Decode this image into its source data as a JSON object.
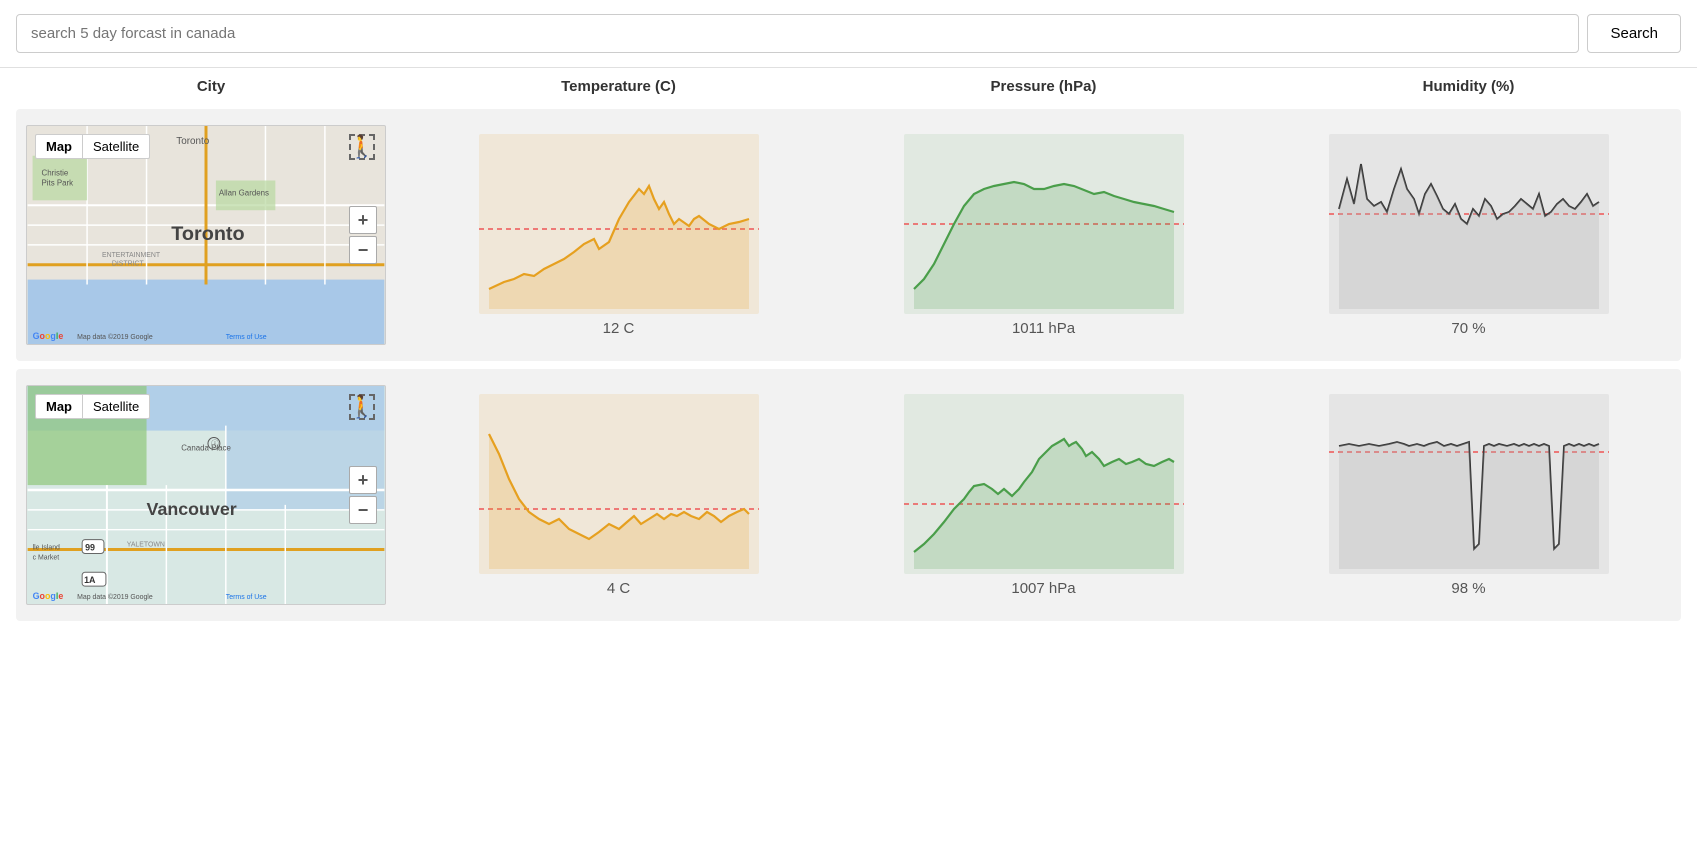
{
  "search": {
    "placeholder": "search 5 day forcast in canada",
    "button_label": "Search"
  },
  "columns": {
    "city": "City",
    "temperature": "Temperature (C)",
    "pressure": "Pressure (hPa)",
    "humidity": "Humidity (%)"
  },
  "cities": [
    {
      "name": "Toronto",
      "temperature_value": "12 C",
      "pressure_value": "1011 hPa",
      "humidity_value": "70 %",
      "map_type": "toronto",
      "temp_color": "#e6a020",
      "temp_bg": "rgba(230,160,32,0.15)",
      "pressure_color": "#4a9e4a",
      "pressure_bg": "rgba(74,158,74,0.15)",
      "humidity_color": "#333",
      "humidity_bg": "rgba(180,180,180,0.25)"
    },
    {
      "name": "Vancouver",
      "temperature_value": "4 C",
      "pressure_value": "1007 hPa",
      "humidity_value": "98 %",
      "map_type": "vancouver",
      "temp_color": "#e6a020",
      "temp_bg": "rgba(230,160,32,0.15)",
      "pressure_color": "#4a9e4a",
      "pressure_bg": "rgba(74,158,74,0.15)",
      "humidity_color": "#333",
      "humidity_bg": "rgba(180,180,180,0.25)"
    }
  ],
  "map_controls": {
    "map_label": "Map",
    "satellite_label": "Satellite",
    "zoom_in": "+",
    "zoom_out": "−"
  },
  "map_footer": "Map data ©2019 Google  Terms of Use"
}
